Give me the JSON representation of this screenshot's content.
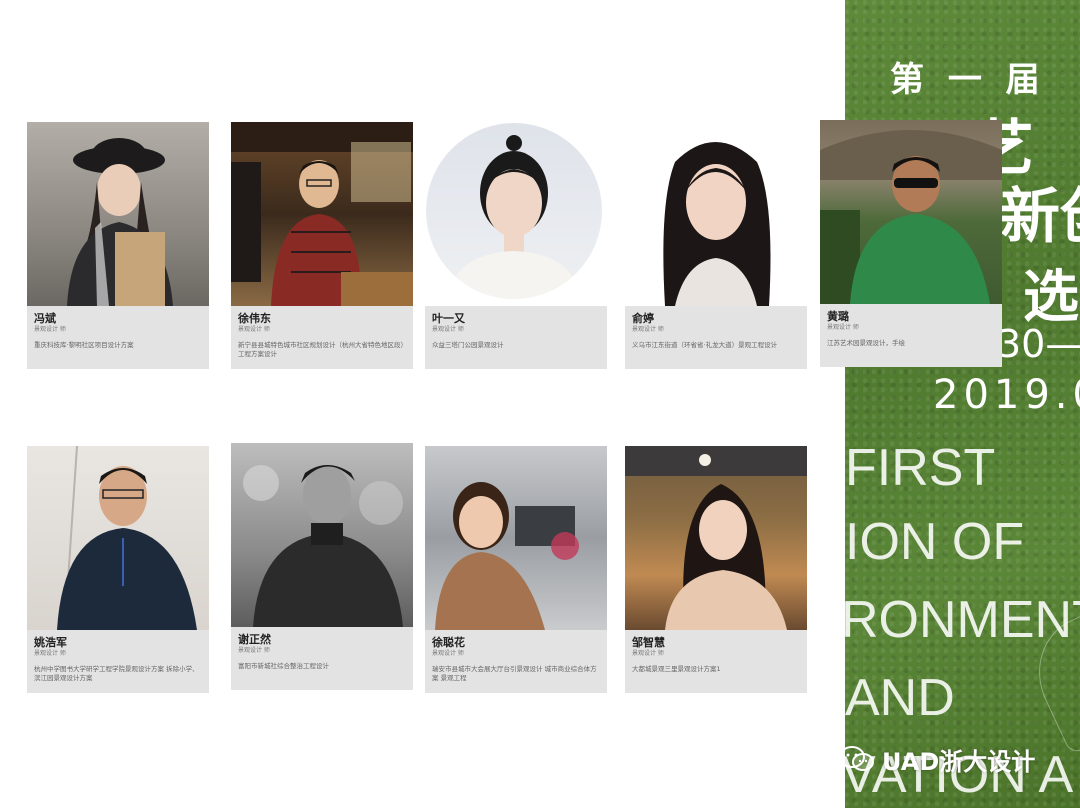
{
  "side_panel": {
    "line1": "第 一 届",
    "line2": "环   艺",
    "line3": "新创",
    "line4": "选",
    "line5": "30—",
    "line6": "2019.0",
    "en1": "FIRST",
    "en2": "ION OF",
    "en3": "RONMENT",
    "en4": "AND",
    "en5": "VATION A"
  },
  "watermark": "UAD浙大设计",
  "profiles": [
    {
      "name": "冯斌",
      "role": "景观设计 师",
      "desc": "重庆科技库·黎明社区项目设计方案"
    },
    {
      "name": "徐伟东",
      "role": "景观设计 师",
      "desc": "新宁县县城特色城市社区规划设计（杭州大省特色地区段）工程方案设计"
    },
    {
      "name": "叶一又",
      "role": "景观设计 师",
      "desc": "众益三塔门公园景观设计"
    },
    {
      "name": "俞婷",
      "role": "景观设计 师",
      "desc": "义乌市江东街道（环省省·礼龙大道）景观工程设计"
    },
    {
      "name": "黄璐",
      "role": "景观设计 师",
      "desc": "江苏艺术园景观设计，手绘"
    },
    {
      "name": "姚浩军",
      "role": "景观设计 师",
      "desc": "杭州中学图书大学研学工程学院景观设计方案 拆除小学、滨江园景观设计方案"
    },
    {
      "name": "谢正然",
      "role": "景观设计 师",
      "desc": "富阳市新城社综合整治工程设计"
    },
    {
      "name": "徐聪花",
      "role": "景观设计 师",
      "desc": "瑞安市县城市大会展大厅台引景观设计 城市商业综合体方案 景观工程"
    },
    {
      "name": "邹智慧",
      "role": "景观设计 师",
      "desc": "大都城景观三里景观设计方案1"
    }
  ],
  "colors": {
    "panel_green": "#557f33",
    "card_gray": "#e3e3e3"
  }
}
